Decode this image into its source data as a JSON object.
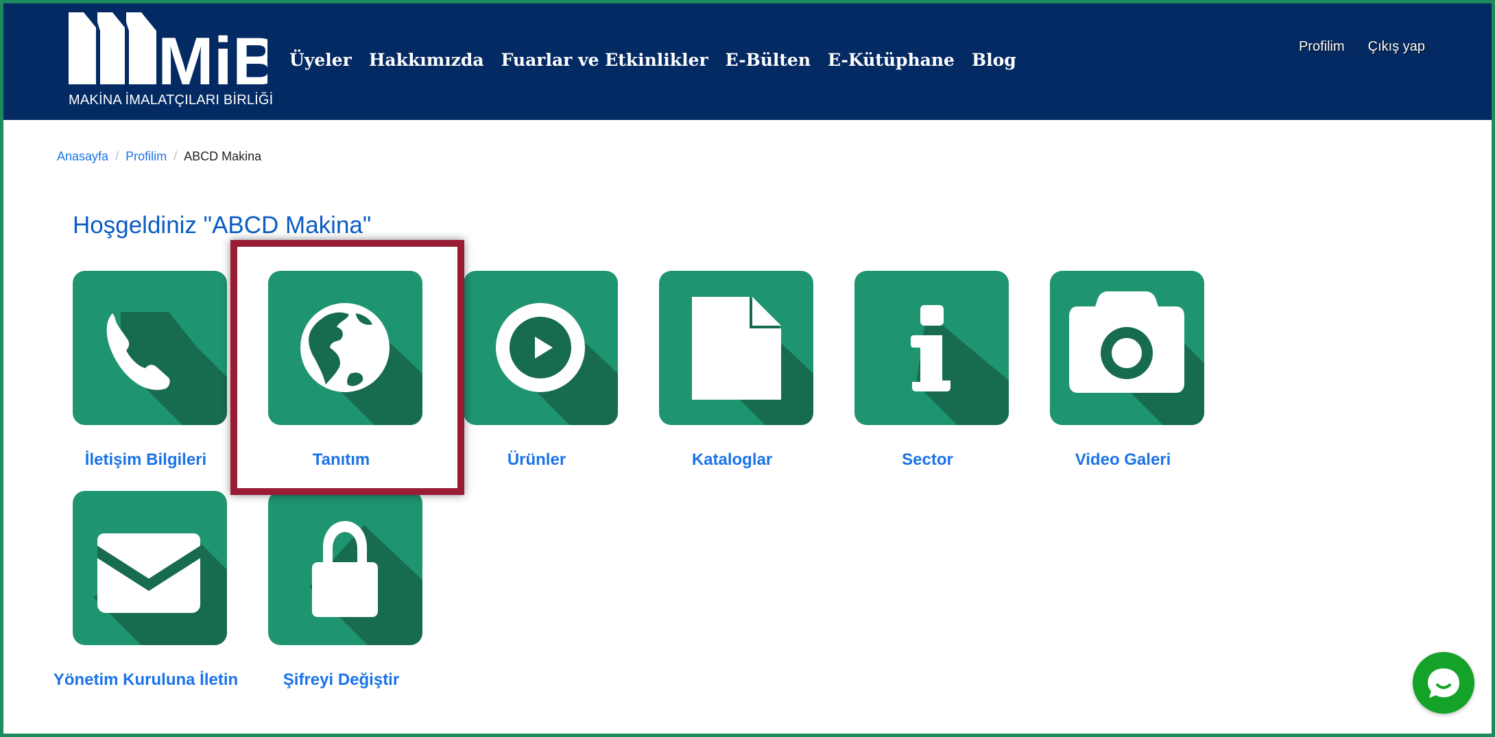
{
  "brand": {
    "logo_text": "MiB",
    "logo_subtitle": "MAKİNA İMALATÇILARI BİRLİĞİ"
  },
  "nav": {
    "items": [
      "Üyeler",
      "Hakkımızda",
      "Fuarlar ve Etkinlikler",
      "E-Bülten",
      "E-Kütüphane",
      "Blog"
    ]
  },
  "user_nav": {
    "profile": "Profilim",
    "logout": "Çıkış yap"
  },
  "breadcrumb": {
    "home": "Anasayfa",
    "profile": "Profilim",
    "current": "ABCD Makina"
  },
  "welcome_title": "Hoşgeldiniz \"ABCD Makina\"",
  "tiles": [
    {
      "label": "İletişim Bilgileri",
      "icon": "phone-icon"
    },
    {
      "label": "Tanıtım",
      "icon": "globe-icon"
    },
    {
      "label": "Ürünler",
      "icon": "play-circle-icon"
    },
    {
      "label": "Kataloglar",
      "icon": "document-icon"
    },
    {
      "label": "Sector",
      "icon": "info-icon"
    },
    {
      "label": "Video Galeri",
      "icon": "camera-icon"
    },
    {
      "label": "Yönetim Kuruluna İletin",
      "icon": "envelope-icon"
    },
    {
      "label": "Şifreyi Değiştir",
      "icon": "lock-icon"
    }
  ],
  "highlighted_tile": "Tanıtım",
  "colors": {
    "header_bg": "#042a63",
    "tile_green": "#1f9470",
    "tile_shadow": "#176b4f",
    "link_blue": "#1a73e8",
    "title_blue": "#0a5bc4",
    "highlight_border": "#971c34",
    "chat_green": "#14a228",
    "page_border": "#1e8a5e"
  },
  "chat": {
    "icon": "chat-bubble-icon"
  }
}
